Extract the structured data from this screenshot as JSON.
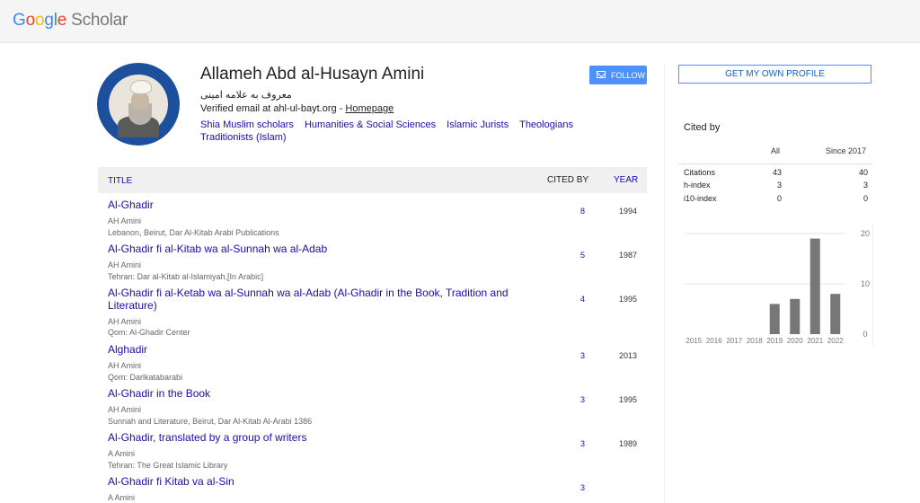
{
  "logo": {
    "letters": [
      "G",
      "o",
      "o",
      "g",
      "l",
      "e"
    ],
    "product": "Scholar"
  },
  "profile": {
    "name": "Allameh Abd al-Husayn Amini",
    "affiliation": "معروف به علامه امینی",
    "email_text": "Verified email at ahl-ul-bayt.org - ",
    "homepage": "Homepage",
    "follow": "FOLLOW",
    "interests": [
      "Shia Muslim scholars",
      "Humanities & Social Sciences",
      "Islamic Jurists",
      "Theologians",
      "Traditionists (Islam)"
    ]
  },
  "table": {
    "header": {
      "title": "TITLE",
      "cited": "CITED BY",
      "year": "YEAR"
    },
    "rows": [
      {
        "title": "Al-Ghadir",
        "authors": "AH Amini",
        "pub": "Lebanon, Beirut, Dar Al-Kitab Arabi Publications",
        "cited": "8",
        "year": "1994"
      },
      {
        "title": "Al-Ghadir fi al-Kitab wa al-Sunnah wa al-Adab",
        "authors": "AH Amini",
        "pub": "Tehran: Dar al-Kitab al-Islamiyah,[In Arabic]",
        "cited": "5",
        "year": "1987"
      },
      {
        "title": "Al-Ghadir fi al-Ketab wa al-Sunnah wa al-Adab (Al-Ghadir in the Book, Tradition and Literature)",
        "authors": "AH Amini",
        "pub": "Qom: Al-Ghadir Center",
        "cited": "4",
        "year": "1995"
      },
      {
        "title": "Alghadir",
        "authors": "AH Amini",
        "pub": "Qom: Darlkatabarabi",
        "cited": "3",
        "year": "2013"
      },
      {
        "title": "Al-Ghadir in the Book",
        "authors": "AH Amini",
        "pub": "Sunnah and Literature, Beirut, Dar Al-Kitab Al-Arabi 1386",
        "cited": "3",
        "year": "1995"
      },
      {
        "title": "Al-Ghadir, translated by a group of writers",
        "authors": "A Amini",
        "pub": "Tehran: The Great Islamic Library",
        "cited": "3",
        "year": "1989"
      },
      {
        "title": "Al-Ghadir fi Kitab va al-Sin",
        "authors": "A Amini",
        "pub": "",
        "cited": "3",
        "year": ""
      }
    ]
  },
  "sidebar": {
    "get_profile": "GET MY OWN PROFILE",
    "cited_by": "Cited by",
    "col_all": "All",
    "col_since": "Since 2017",
    "metrics": [
      {
        "label": "Citations",
        "all": "43",
        "since": "40"
      },
      {
        "label": "h-index",
        "all": "3",
        "since": "3"
      },
      {
        "label": "i10-index",
        "all": "0",
        "since": "0"
      }
    ]
  },
  "chart_data": {
    "type": "bar",
    "categories": [
      "2015",
      "2016",
      "2017",
      "2018",
      "2019",
      "2020",
      "2021",
      "2022"
    ],
    "values": [
      0,
      0,
      0,
      0,
      6,
      7,
      19,
      8
    ],
    "ylim": [
      0,
      20
    ],
    "yticks": [
      "20",
      "10",
      "0"
    ],
    "bar_color": "#777777",
    "grid": true
  }
}
